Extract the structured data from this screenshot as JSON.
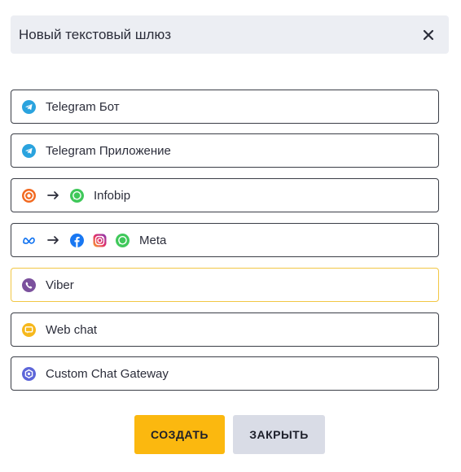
{
  "dialog": {
    "title": "Новый текстовый шлюз"
  },
  "options": [
    {
      "label": "Telegram Бот",
      "icons": [
        "telegram-icon"
      ]
    },
    {
      "label": "Telegram Приложение",
      "icons": [
        "telegram-icon"
      ]
    },
    {
      "label": "Infobip",
      "icons": [
        "infobip-icon",
        "arrow-right-icon",
        "whatsapp-icon"
      ]
    },
    {
      "label": "Meta",
      "icons": [
        "meta-icon",
        "arrow-right-icon",
        "facebook-icon",
        "instagram-icon",
        "whatsapp-icon"
      ]
    },
    {
      "label": "Viber",
      "icons": [
        "viber-icon"
      ],
      "selected": true
    },
    {
      "label": "Web chat",
      "icons": [
        "web-chat-icon"
      ]
    },
    {
      "label": "Custom Chat Gateway",
      "icons": [
        "custom-gateway-icon"
      ]
    }
  ],
  "buttons": {
    "create": "СОЗДАТЬ",
    "close": "ЗАКРЫТЬ"
  },
  "colors": {
    "accent": "#fbb80f",
    "selected_border": "#f2c744",
    "secondary_button": "#d9dce6",
    "header_bg": "#eceef3"
  }
}
